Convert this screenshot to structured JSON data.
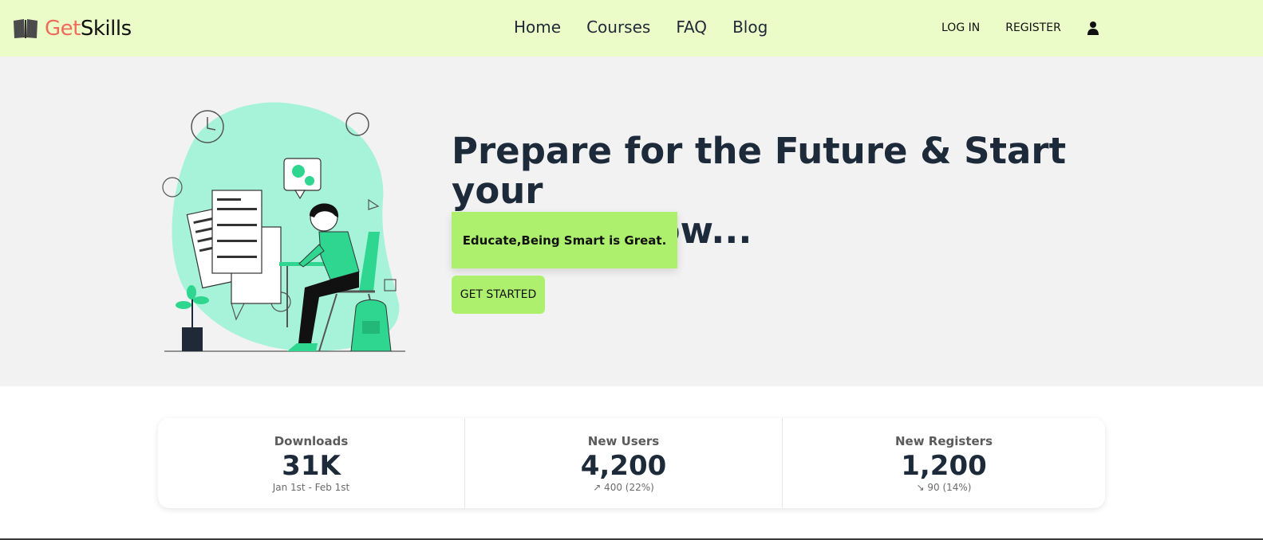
{
  "brand": {
    "prefix": "Get",
    "suffix": "Skills",
    "accent_color": "#ef6b5b"
  },
  "nav": {
    "links": [
      {
        "label": "Home"
      },
      {
        "label": "Courses"
      },
      {
        "label": "FAQ"
      },
      {
        "label": "Blog"
      }
    ],
    "login_label": "LOG IN",
    "register_label": "REGISTER",
    "user_icon": "user-icon"
  },
  "hero": {
    "headline_line1": "Prepare for the Future & Start your",
    "headline_line2": "Courses Now...",
    "tagline": "Educate,Being Smart is Great.",
    "cta_label": "GET STARTED",
    "accent_color": "#adf06d"
  },
  "stats": [
    {
      "title": "Downloads",
      "value": "31K",
      "desc": "Jan 1st - Feb 1st"
    },
    {
      "title": "New Users",
      "value": "4,200",
      "desc": "↗︎ 400 (22%)"
    },
    {
      "title": "New Registers",
      "value": "1,200",
      "desc": "↘︎ 90 (14%)"
    }
  ],
  "colors": {
    "navbar_bg": "#ebfcc9",
    "hero_bg": "#f2f2f2",
    "illustration_green": "#a7f3d9",
    "illustration_accent": "#2fd68f"
  }
}
